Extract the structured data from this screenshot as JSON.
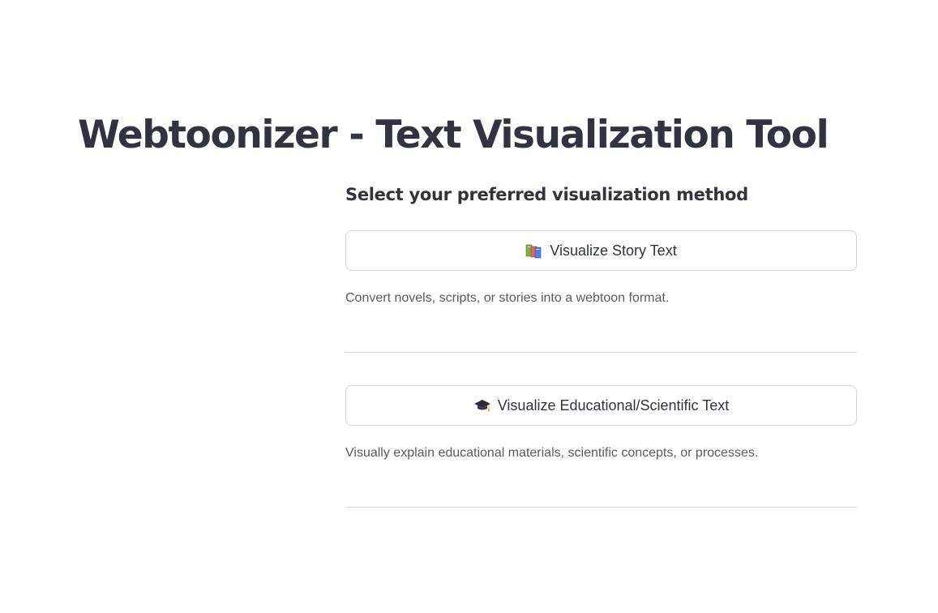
{
  "page": {
    "title": "Webtoonizer - Text Visualization Tool"
  },
  "main": {
    "heading": "Select your preferred visualization method",
    "options": [
      {
        "icon": "books-icon",
        "label": "Visualize Story Text",
        "description": "Convert novels, scripts, or stories into a webtoon format."
      },
      {
        "icon": "graduation-cap-icon",
        "label": "Visualize Educational/Scientific Text",
        "description": "Visually explain educational materials, scientific concepts, or processes."
      }
    ]
  },
  "colors": {
    "text": "#31333f",
    "muted_text": "#5a5b66",
    "border": "#d6d6d9",
    "divider": "#d9d9dd",
    "background": "#ffffff"
  }
}
